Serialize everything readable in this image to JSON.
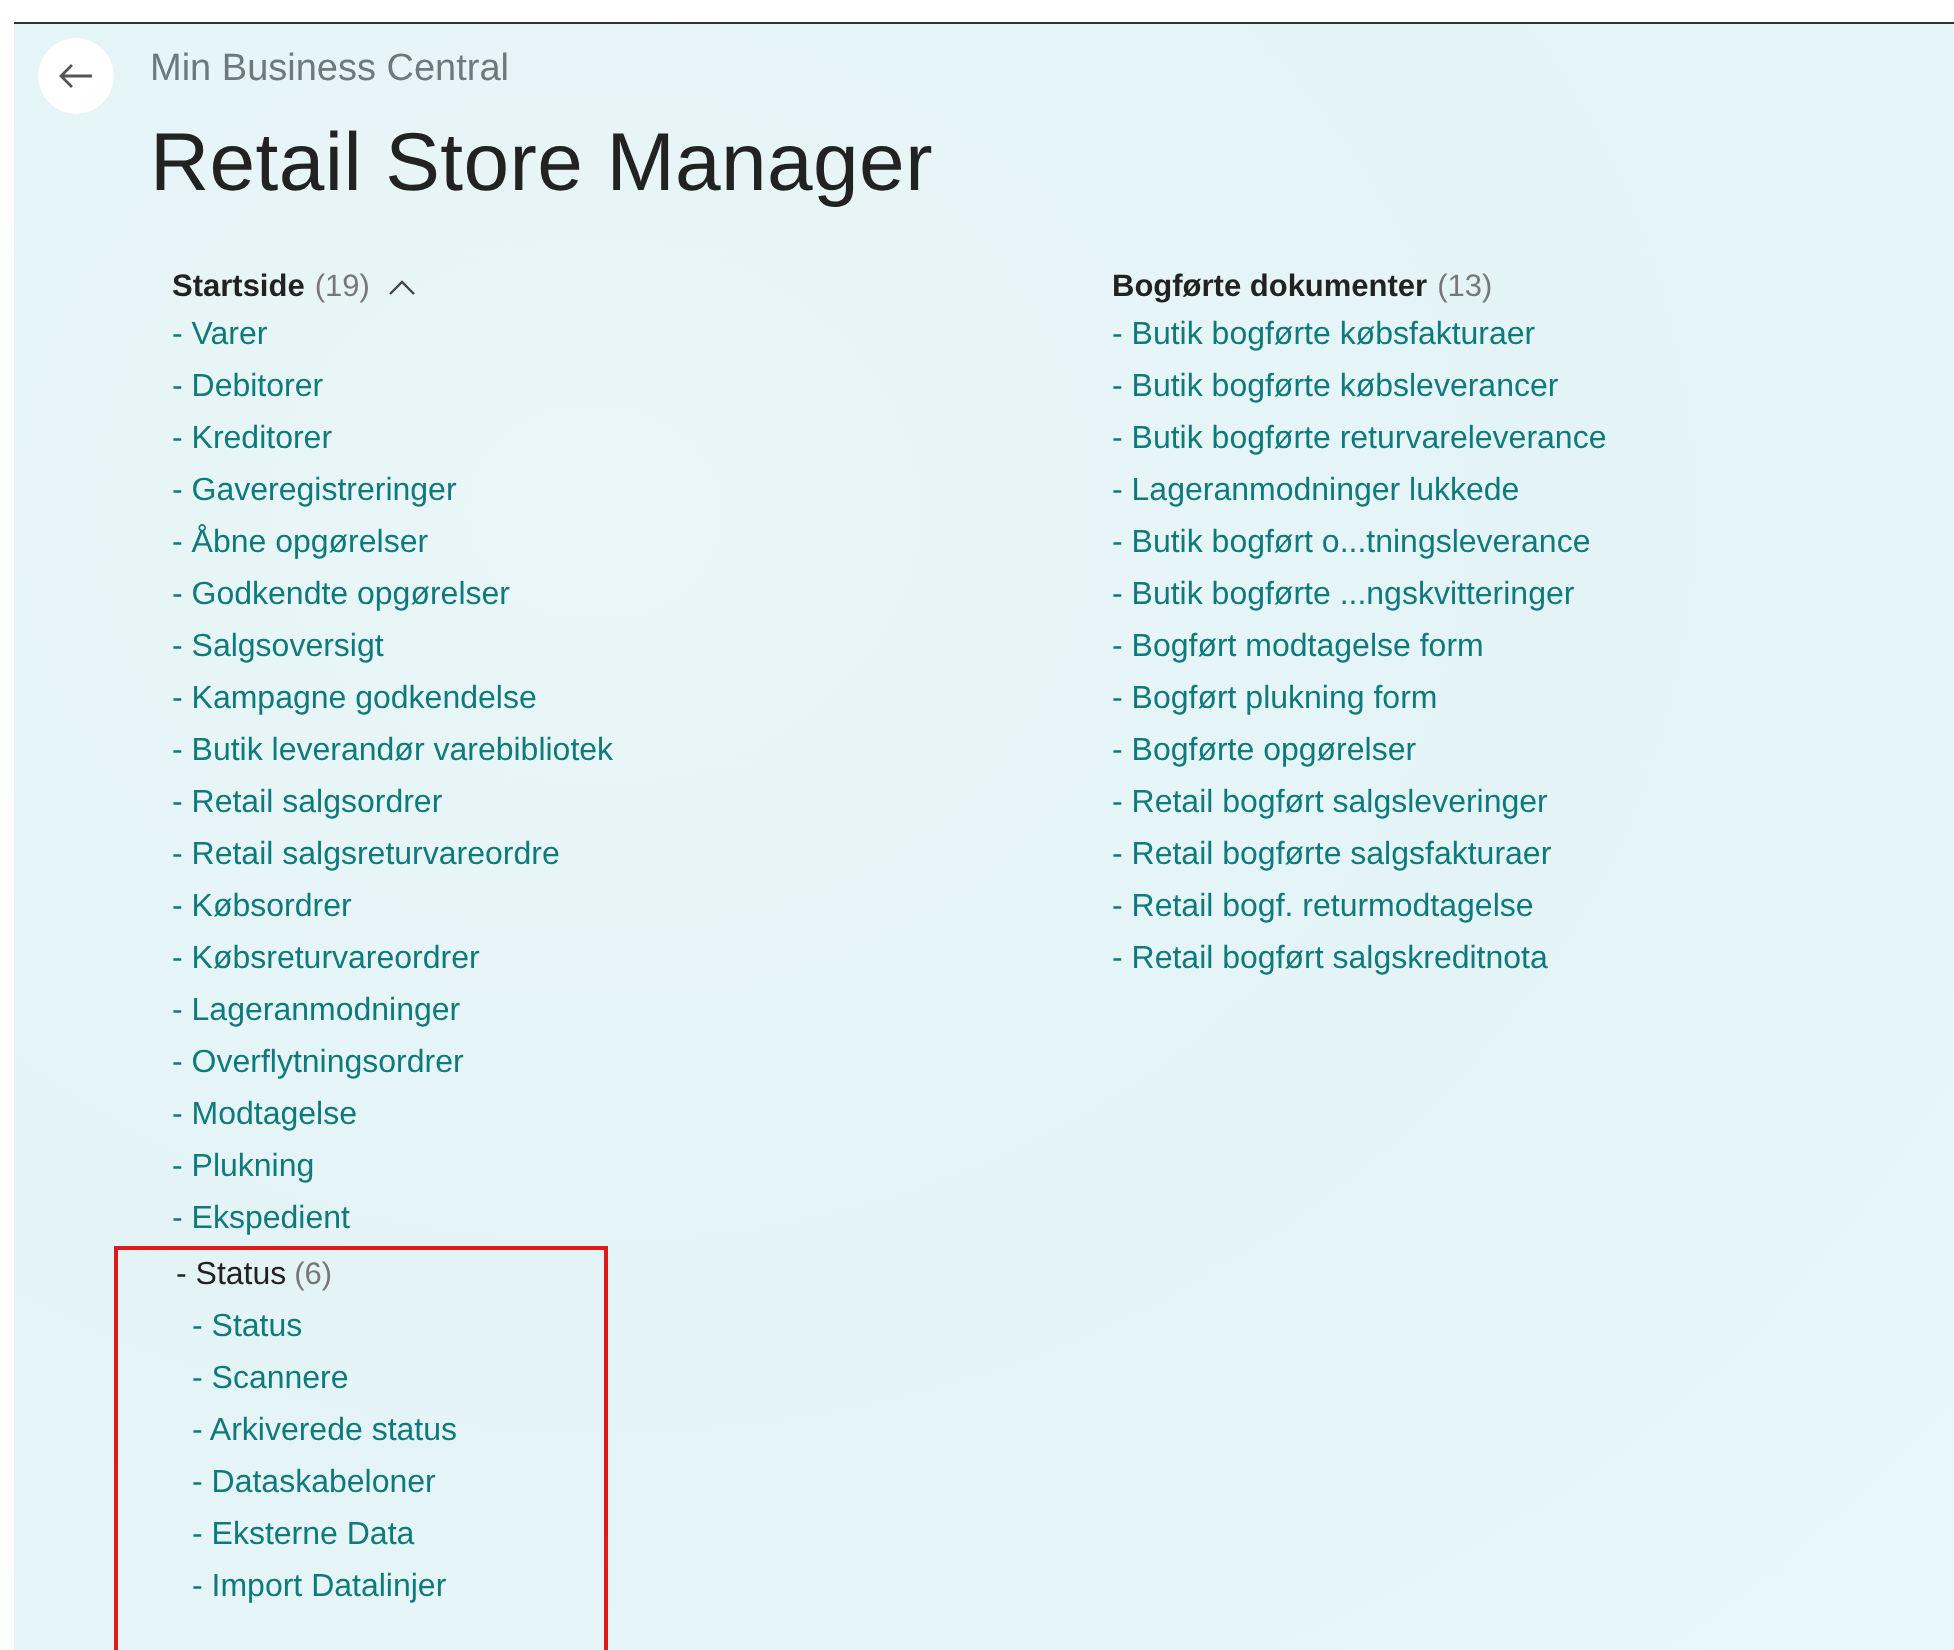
{
  "breadcrumb": "Min Business Central",
  "title": "Retail Store Manager",
  "sections": [
    {
      "label": "Startside",
      "count": "(19)",
      "expanded": true,
      "items": [
        {
          "text": "- Varer"
        },
        {
          "text": "- Debitorer"
        },
        {
          "text": "- Kreditorer"
        },
        {
          "text": "- Gaveregistreringer"
        },
        {
          "text": "- Åbne opgørelser"
        },
        {
          "text": "- Godkendte opgørelser"
        },
        {
          "text": "- Salgsoversigt"
        },
        {
          "text": "- Kampagne godkendelse"
        },
        {
          "text": "- Butik leverandør varebibliotek"
        },
        {
          "text": "- Retail salgsordrer"
        },
        {
          "text": "- Retail salgsreturvareordre"
        },
        {
          "text": "- Købsordrer"
        },
        {
          "text": "- Købsreturvareordrer"
        },
        {
          "text": "- Lageranmodninger"
        },
        {
          "text": "- Overflytningsordrer"
        },
        {
          "text": "- Modtagelse"
        },
        {
          "text": "- Plukning"
        },
        {
          "text": "- Ekspedient"
        },
        {
          "text": "- Status",
          "count": "(6)",
          "highlighted": true,
          "children": [
            {
              "text": "- Status"
            },
            {
              "text": "- Scannere"
            },
            {
              "text": "- Arkiverede status"
            },
            {
              "text": "- Dataskabeloner"
            },
            {
              "text": "- Eksterne Data"
            },
            {
              "text": "- Import Datalinjer"
            }
          ]
        }
      ]
    },
    {
      "label": "Bogførte dokumenter",
      "count": "(13)",
      "items": [
        {
          "text": "- Butik bogførte købsfakturaer"
        },
        {
          "text": "- Butik bogførte købsleverancer"
        },
        {
          "text": "- Butik bogførte returvareleverance"
        },
        {
          "text": "- Lageranmodninger lukkede"
        },
        {
          "text": "- Butik bogført o...tningsleverance"
        },
        {
          "text": "- Butik bogførte ...ngskvitteringer"
        },
        {
          "text": "- Bogført modtagelse form"
        },
        {
          "text": "- Bogført plukning form"
        },
        {
          "text": "- Bogførte opgørelser"
        },
        {
          "text": "- Retail bogført salgsleveringer"
        },
        {
          "text": "- Retail bogførte salgsfakturaer"
        },
        {
          "text": "- Retail bogf. returmodtagelse"
        },
        {
          "text": "- Retail bogført salgskreditnota"
        }
      ]
    }
  ]
}
